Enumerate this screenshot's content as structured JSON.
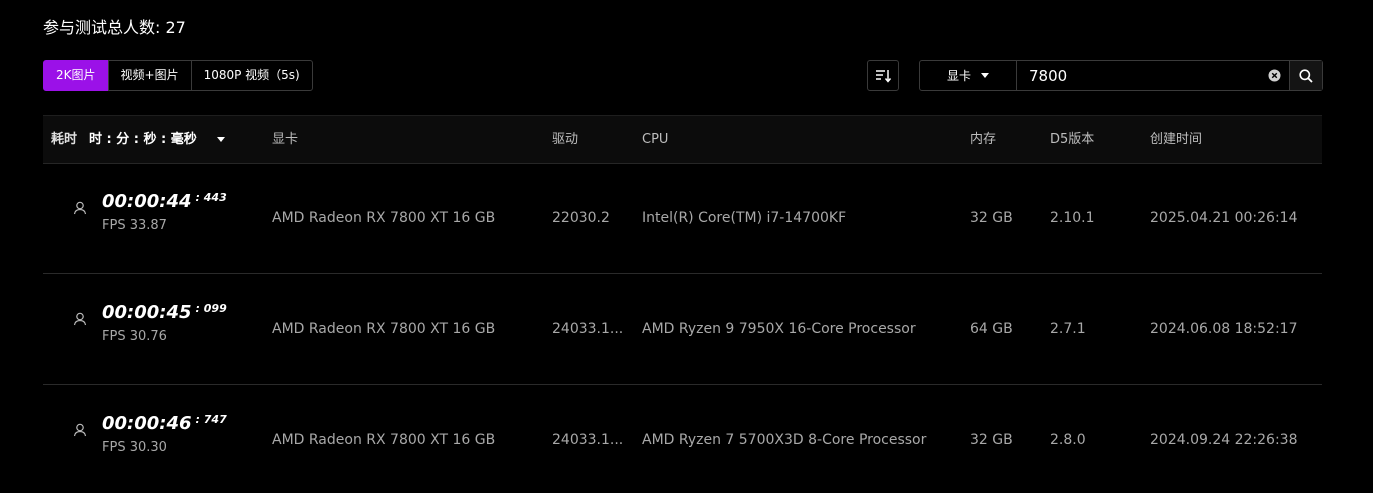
{
  "header": {
    "total_label": "参与测试总人数: 27"
  },
  "tabs": [
    {
      "label": "2K图片",
      "active": true
    },
    {
      "label": "视频+图片",
      "active": false
    },
    {
      "label": "1080P 视频（5s)",
      "active": false
    }
  ],
  "search": {
    "type_label": "显卡",
    "value": "7800",
    "icons": [
      "sort-icon",
      "clear-icon",
      "search-icon"
    ]
  },
  "colors": {
    "accent": "#9b11e8",
    "background": "#000000"
  },
  "table": {
    "headers": {
      "time": "耗时",
      "time_format": "时 : 分 : 秒 : 毫秒",
      "gpu": "显卡",
      "driver": "驱动",
      "cpu": "CPU",
      "memory": "内存",
      "d5": "D5版本",
      "created": "创建时间"
    },
    "rows": [
      {
        "time": "00:00:44",
        "ms": ": 443",
        "fps": "FPS 33.87",
        "gpu": "AMD Radeon RX 7800 XT 16 GB",
        "driver": "22030.2",
        "cpu": "Intel(R) Core(TM) i7-14700KF",
        "memory": "32 GB",
        "d5": "2.10.1",
        "created": "2025.04.21 00:26:14"
      },
      {
        "time": "00:00:45",
        "ms": ": 099",
        "fps": "FPS 30.76",
        "gpu": "AMD Radeon RX 7800 XT 16 GB",
        "driver": "24033.1...",
        "cpu": "AMD Ryzen 9 7950X 16-Core Processor",
        "memory": "64 GB",
        "d5": "2.7.1",
        "created": "2024.06.08 18:52:17"
      },
      {
        "time": "00:00:46",
        "ms": ": 747",
        "fps": "FPS 30.30",
        "gpu": "AMD Radeon RX 7800 XT 16 GB",
        "driver": "24033.1...",
        "cpu": "AMD Ryzen 7 5700X3D 8-Core Processor",
        "memory": "32 GB",
        "d5": "2.8.0",
        "created": "2024.09.24 22:26:38"
      }
    ]
  }
}
